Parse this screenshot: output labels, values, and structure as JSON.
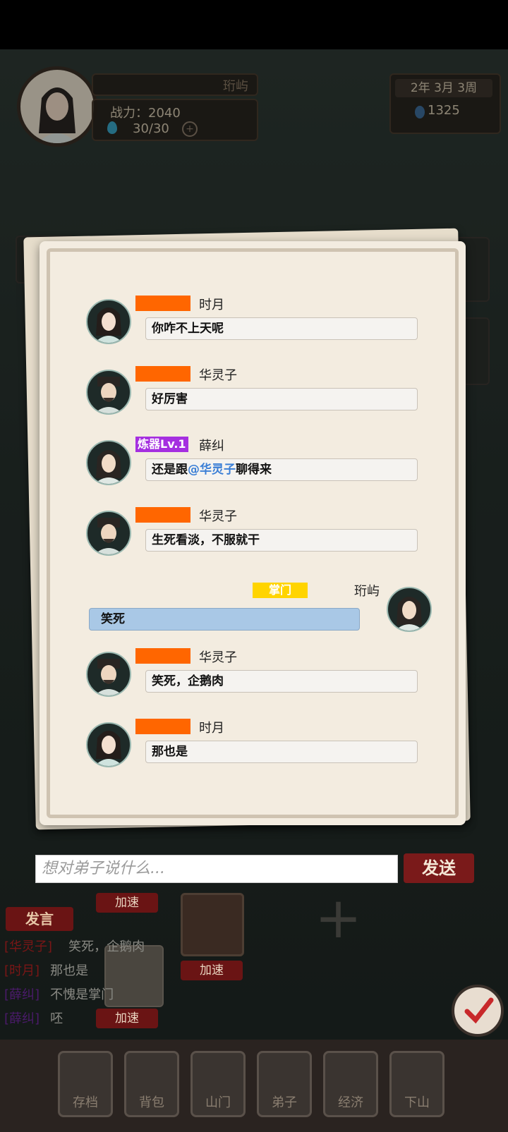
{
  "header": {
    "player_name": "珩屿",
    "power": "战力：2040",
    "stamina": "30/30",
    "date": "2年   3月  3周",
    "currency": "1325"
  },
  "chat": {
    "messages": [
      {
        "tag": "",
        "sender": "时月",
        "text": "你咋不上天呢"
      },
      {
        "tag": "",
        "sender": "华灵子",
        "text": "好厉害"
      },
      {
        "tag": "炼器Lv.1",
        "sender": "薛纠",
        "text_before": "还是跟",
        "mention": "@华灵子",
        "text_after": "聊得来"
      },
      {
        "tag": "",
        "sender": "华灵子",
        "text": "生死看淡，不服就干"
      },
      {
        "tag": "掌门",
        "sender": "珩屿",
        "text": "笑死",
        "self": true
      },
      {
        "tag": "",
        "sender": "华灵子",
        "text": "笑死，企鹅肉"
      },
      {
        "tag": "",
        "sender": "时月",
        "text": "那也是"
      }
    ]
  },
  "input": {
    "placeholder": "想对弟子说什么..."
  },
  "send_label": "发送",
  "lower": {
    "speak_label": "发言",
    "speed_labels": [
      "加速",
      "加速",
      "加速"
    ],
    "log": [
      {
        "name": "[华灵子]",
        "text": "笑死，企鹅肉"
      },
      {
        "name": "[时月]",
        "text": "那也是"
      },
      {
        "name": "[薛纠]",
        "text": "不愧是掌门"
      },
      {
        "name": "[薛纠]",
        "text": "呸"
      }
    ]
  },
  "nav": [
    "存档",
    "背包",
    "山门",
    "弟子",
    "经济",
    "下山"
  ],
  "colors": {
    "tag_orange": "#ff6600",
    "tag_purple": "#a52fe0",
    "tag_yellow": "#ffd400",
    "self_bubble": "#a9c8e6",
    "send_button": "#7a1a1a"
  }
}
